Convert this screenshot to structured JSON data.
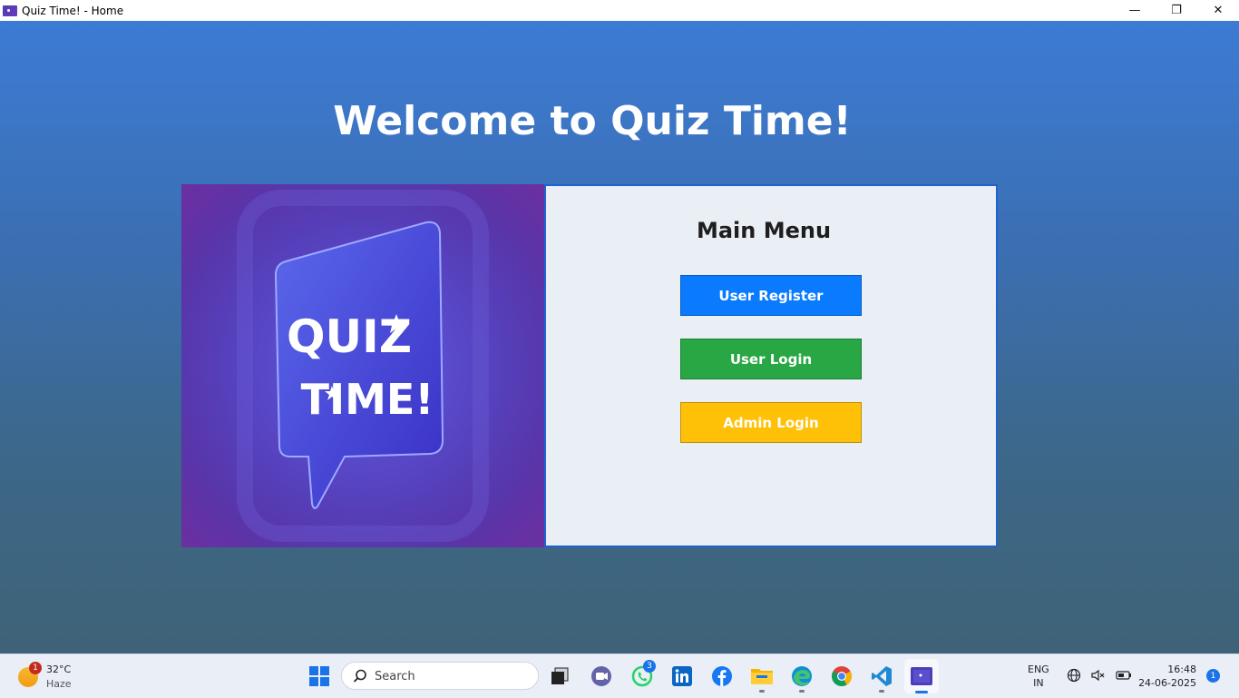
{
  "window": {
    "title": "Quiz Time! - Home",
    "controls": [
      "—",
      "❐",
      "✕"
    ]
  },
  "page": {
    "heading": "Welcome to Quiz Time!"
  },
  "banner": {
    "line1": "QUIZ",
    "line2": "TIME!"
  },
  "menu": {
    "title": "Main Menu",
    "buttons": [
      {
        "label": "User Register",
        "color": "#0a7bff"
      },
      {
        "label": "User Login",
        "color": "#29a745"
      },
      {
        "label": "Admin Login",
        "color": "#ffc107"
      }
    ]
  },
  "taskbar": {
    "weather": {
      "temp": "32°C",
      "condition": "Haze",
      "badge": "1"
    },
    "search_placeholder": "Search",
    "whatsapp_badge": "3",
    "language": {
      "line1": "ENG",
      "line2": "IN"
    },
    "clock": {
      "time": "16:48",
      "date": "24-06-2025"
    },
    "notifications": "1"
  }
}
